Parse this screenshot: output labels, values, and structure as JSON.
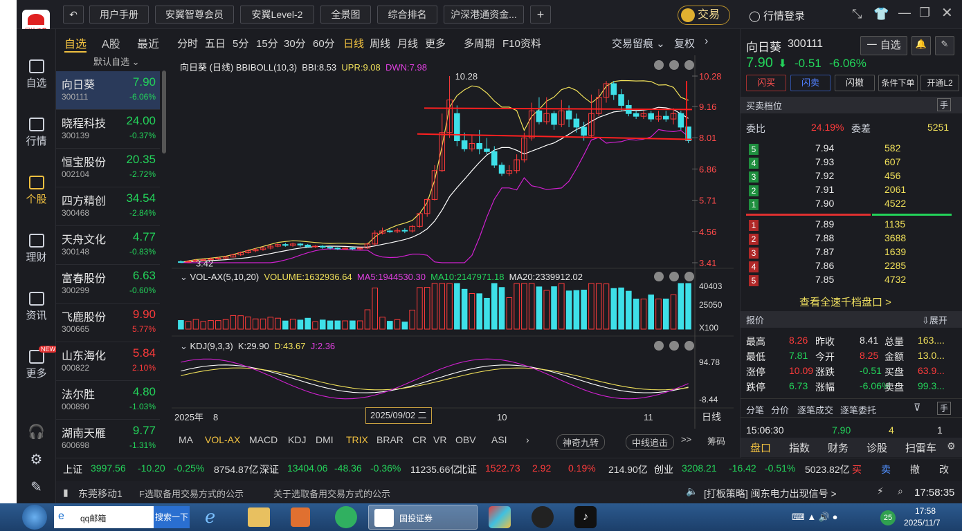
{
  "app": {
    "logo_text": "国投证券",
    "trade": "交易",
    "login": "行情登录"
  },
  "top": {
    "tabs": [
      "用户手册",
      "安翼智尊会员",
      "安翼Level-2",
      "全景图",
      "综合排名",
      "沪深港通资金..."
    ]
  },
  "rail": [
    "自选",
    "行情",
    "个股",
    "理财",
    "资讯",
    "更多"
  ],
  "rail_badge": "NEW",
  "watch": {
    "tabs": [
      "自选",
      "A股",
      "最近"
    ],
    "sub": "默认自选",
    "items": [
      {
        "name": "向日葵",
        "code": "300111",
        "price": "7.90",
        "pct": "-6.06%",
        "dir": "dn"
      },
      {
        "name": "晓程科技",
        "code": "300139",
        "price": "24.00",
        "pct": "-0.37%",
        "dir": "dn"
      },
      {
        "name": "恒宝股份",
        "code": "002104",
        "price": "20.35",
        "pct": "-2.72%",
        "dir": "dn"
      },
      {
        "name": "四方精创",
        "code": "300468",
        "price": "34.54",
        "pct": "-2.84%",
        "dir": "dn"
      },
      {
        "name": "天舟文化",
        "code": "300148",
        "price": "4.77",
        "pct": "-0.83%",
        "dir": "dn"
      },
      {
        "name": "富春股份",
        "code": "300299",
        "price": "6.63",
        "pct": "-0.60%",
        "dir": "dn"
      },
      {
        "name": "飞鹿股份",
        "code": "300665",
        "price": "9.90",
        "pct": "5.77%",
        "dir": "up"
      },
      {
        "name": "山东海化",
        "code": "000822",
        "price": "5.84",
        "pct": "2.10%",
        "dir": "up"
      },
      {
        "name": "法尔胜",
        "code": "000890",
        "price": "4.80",
        "pct": "-1.03%",
        "dir": "dn"
      },
      {
        "name": "湖南天雁",
        "code": "600698",
        "price": "9.77",
        "pct": "-1.31%",
        "dir": "dn"
      }
    ]
  },
  "periods": [
    "分时",
    "五日",
    "5分",
    "15分",
    "30分",
    "60分",
    "日线",
    "周线",
    "月线",
    "更多",
    "多周期",
    "F10资料"
  ],
  "period_right": [
    "交易留痕",
    "复权"
  ],
  "main": {
    "title": "向日葵 (日线) BBIBOLL(10,3)",
    "bbi": "BBI:8.53",
    "upr": "UPR:9.08",
    "dwn": "DWN:7.98",
    "yticks": [
      "10.28",
      "9.16",
      "8.01",
      "6.86",
      "5.71",
      "4.56",
      "3.41"
    ],
    "hi_label": "10.28",
    "lo_label": "3.42"
  },
  "vol": {
    "title": "VOL-AX(5,10,20)",
    "volume": "VOLUME:1632936.64",
    "ma5": "MA5:1944530.30",
    "ma10": "MA10:2147971.18",
    "ma20": "MA20:2339912.02",
    "yticks": [
      "40403",
      "25050",
      "X100"
    ]
  },
  "kdj": {
    "title": "KDJ(9,3,3)",
    "k": "K:29.90",
    "d": "D:43.67",
    "j": "J:2.36",
    "yticks": [
      "94.78",
      "-8.44"
    ]
  },
  "xaxis": {
    "labels": [
      "2025年",
      "8",
      "10",
      "11"
    ],
    "cursor": "2025/09/02 二",
    "period": "日线"
  },
  "indicators": [
    "MA",
    "VOL-AX",
    "MACD",
    "KDJ",
    "DMI",
    "TRIX",
    "BRAR",
    "CR",
    "VR",
    "OBV",
    "ASI"
  ],
  "ind_right": [
    "神奇九转",
    "中线追击",
    ">>",
    "筹码"
  ],
  "quote": {
    "name": "向日葵",
    "code": "300111",
    "price": "7.90",
    "chg": "-0.51",
    "pct": "-6.06%",
    "watch_btn": "一 自选",
    "actions": [
      "闪买",
      "闪卖",
      "闪撤",
      "条件下单",
      "开通L2"
    ],
    "book_title": "买卖档位",
    "hand": "手",
    "wb_label": "委比",
    "wb": "24.19%",
    "wc_label": "委差",
    "wc": "5251",
    "asks": [
      [
        "5",
        "7.94",
        "582"
      ],
      [
        "4",
        "7.93",
        "607"
      ],
      [
        "3",
        "7.92",
        "456"
      ],
      [
        "2",
        "7.91",
        "2061"
      ],
      [
        "1",
        "7.90",
        "4522"
      ]
    ],
    "bids": [
      [
        "1",
        "7.89",
        "1135"
      ],
      [
        "2",
        "7.88",
        "3688"
      ],
      [
        "3",
        "7.87",
        "1639"
      ],
      [
        "4",
        "7.86",
        "2285"
      ],
      [
        "5",
        "7.85",
        "4732"
      ]
    ],
    "deep": "查看全速千档盘口 >",
    "price_title": "报价",
    "expand": "展开",
    "stats": [
      [
        "最高",
        "8.26",
        "昨收",
        "8.41",
        "总量",
        "163...."
      ],
      [
        "最低",
        "7.81",
        "今开",
        "8.25",
        "金额",
        "13.0..."
      ],
      [
        "涨停",
        "10.09",
        "涨跌",
        "-0.51",
        "买盘",
        "63.9..."
      ],
      [
        "跌停",
        "6.73",
        "涨幅",
        "-6.06%",
        "卖盘",
        "99.3..."
      ]
    ],
    "tick_tabs": [
      "分笔",
      "分价",
      "逐笔成交",
      "逐笔委托"
    ],
    "tick": [
      "15:06:30",
      "7.90",
      "4",
      "1"
    ],
    "bottom_tabs": [
      "盘口",
      "指数",
      "财务",
      "诊股",
      "扫雷车"
    ]
  },
  "ticker": {
    "sh": [
      "上证",
      "3997.56",
      "-10.20",
      "-0.25%",
      "8754.87亿"
    ],
    "sz": [
      "深证",
      "13404.06",
      "-48.36",
      "-0.36%",
      "11235.66亿"
    ],
    "bz": [
      "北证",
      "1522.73",
      "2.92",
      "0.19%",
      "214.90亿"
    ],
    "cy": [
      "创业",
      "3208.21",
      "-16.42",
      "-0.51%",
      "5023.82亿"
    ],
    "btns": [
      "买",
      "卖",
      "撤",
      "改"
    ]
  },
  "status": {
    "net": "东莞移动1",
    "notice1": "F选取备用交易方式的公示",
    "notice2": "关于选取备用交易方式的公示",
    "strategy": "[打板策略] 闽东电力出现信号 >",
    "time": "17:58:35"
  },
  "taskbar": {
    "search": "qq邮箱",
    "search_btn": "搜索一下",
    "app": "国投证券",
    "time": "17:58",
    "date": "2025/11/7",
    "badge": "25"
  },
  "chart_data": {
    "type": "candlestick",
    "title": "向日葵 (日线)",
    "ylim": [
      3.41,
      10.28
    ],
    "candles": [
      [
        3.45,
        3.42,
        3.5,
        3.4
      ],
      [
        3.44,
        3.46,
        3.5,
        3.42
      ],
      [
        3.46,
        3.5,
        3.55,
        3.44
      ],
      [
        3.5,
        3.52,
        3.56,
        3.47
      ],
      [
        3.52,
        3.55,
        3.6,
        3.5
      ],
      [
        3.55,
        3.58,
        3.62,
        3.52
      ],
      [
        3.58,
        3.62,
        3.66,
        3.55
      ],
      [
        3.62,
        3.7,
        3.74,
        3.6
      ],
      [
        3.7,
        3.78,
        3.82,
        3.66
      ],
      [
        3.78,
        3.85,
        3.9,
        3.74
      ],
      [
        3.85,
        3.9,
        3.95,
        3.8
      ],
      [
        3.9,
        3.95,
        4.0,
        3.85
      ],
      [
        3.95,
        4.02,
        4.06,
        3.9
      ],
      [
        4.02,
        4.08,
        4.12,
        3.98
      ],
      [
        4.08,
        4.05,
        4.14,
        4.0
      ],
      [
        4.05,
        4.1,
        4.15,
        4.0
      ],
      [
        4.1,
        4.06,
        4.14,
        4.0
      ],
      [
        4.06,
        4.0,
        4.1,
        3.96
      ],
      [
        4.0,
        4.02,
        4.06,
        3.95
      ],
      [
        4.02,
        3.98,
        4.06,
        3.92
      ],
      [
        3.98,
        3.95,
        4.02,
        3.9
      ],
      [
        3.95,
        3.92,
        3.98,
        3.88
      ],
      [
        3.92,
        3.95,
        3.98,
        3.88
      ],
      [
        3.95,
        3.92,
        3.99,
        3.88
      ],
      [
        3.92,
        3.95,
        3.98,
        3.88
      ],
      [
        3.95,
        4.1,
        4.15,
        3.92
      ],
      [
        4.1,
        4.5,
        4.6,
        4.05
      ],
      [
        4.5,
        4.58,
        4.7,
        4.45
      ],
      [
        4.58,
        4.55,
        4.65,
        4.5
      ],
      [
        4.55,
        4.6,
        4.68,
        4.5
      ],
      [
        4.6,
        4.58,
        4.68,
        4.5
      ],
      [
        4.58,
        4.75,
        4.8,
        4.52
      ],
      [
        4.75,
        5.22,
        5.25,
        4.7
      ],
      [
        5.22,
        5.74,
        5.78,
        5.1
      ],
      [
        5.74,
        6.8,
        7.0,
        5.7
      ],
      [
        6.8,
        8.2,
        8.9,
        6.75
      ],
      [
        8.2,
        9.4,
        10.28,
        8.0
      ],
      [
        8.9,
        7.9,
        9.2,
        7.7
      ],
      [
        7.9,
        7.6,
        8.2,
        7.5
      ],
      [
        7.6,
        7.8,
        8.1,
        7.5
      ],
      [
        7.8,
        7.6,
        8.3,
        7.4
      ],
      [
        7.6,
        7.5,
        8.0,
        7.4
      ],
      [
        7.5,
        7.0,
        7.7,
        6.9
      ],
      [
        7.0,
        6.7,
        7.1,
        6.6
      ],
      [
        6.7,
        6.8,
        7.0,
        6.6
      ],
      [
        6.8,
        7.2,
        7.4,
        6.7
      ],
      [
        7.2,
        8.0,
        8.2,
        7.1
      ],
      [
        8.0,
        9.0,
        9.3,
        7.9
      ],
      [
        9.0,
        8.6,
        9.5,
        8.5
      ],
      [
        8.6,
        8.9,
        9.5,
        8.5
      ],
      [
        8.9,
        8.5,
        9.0,
        8.3
      ],
      [
        8.5,
        9.0,
        9.4,
        8.4
      ],
      [
        9.0,
        8.7,
        9.2,
        8.4
      ],
      [
        8.7,
        8.4,
        8.9,
        8.2
      ],
      [
        8.4,
        8.1,
        8.6,
        7.9
      ],
      [
        8.1,
        8.9,
        9.6,
        8.0
      ],
      [
        8.9,
        9.5,
        9.8,
        8.8
      ],
      [
        9.5,
        10.0,
        10.1,
        9.3
      ],
      [
        10.0,
        9.6,
        10.1,
        9.4
      ],
      [
        9.6,
        9.2,
        9.8,
        9.0
      ],
      [
        9.2,
        8.9,
        9.4,
        8.8
      ],
      [
        8.9,
        8.8,
        9.0,
        8.7
      ],
      [
        8.8,
        8.9,
        9.0,
        8.7
      ],
      [
        8.9,
        8.7,
        9.0,
        8.6
      ],
      [
        8.7,
        8.8,
        9.0,
        8.6
      ],
      [
        8.8,
        8.7,
        9.0,
        8.6
      ],
      [
        8.7,
        8.9,
        9.1,
        8.5
      ],
      [
        8.9,
        8.4,
        9.0,
        8.3
      ],
      [
        8.41,
        7.9,
        8.26,
        7.81
      ]
    ],
    "resistance": 9.1,
    "support": 7.95
  }
}
